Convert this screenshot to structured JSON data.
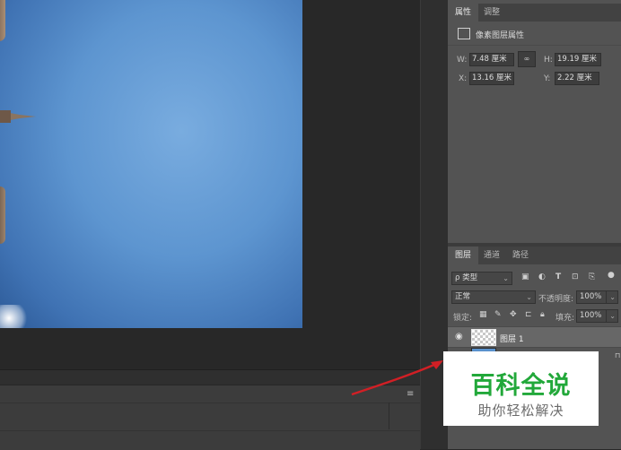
{
  "properties_panel": {
    "tabs": [
      {
        "label": "属性",
        "active": true
      },
      {
        "label": "调整",
        "active": false
      }
    ],
    "title": "像素图层属性",
    "w_label": "W:",
    "w_value": "7.48 厘米",
    "h_label": "H:",
    "h_value": "19.19 厘米",
    "x_label": "X:",
    "x_value": "13.16 厘米",
    "y_label": "Y:",
    "y_value": "2.22 厘米",
    "link_icon": "link-icon"
  },
  "layers_panel": {
    "tabs": [
      {
        "label": "图层",
        "active": true
      },
      {
        "label": "通道",
        "active": false
      },
      {
        "label": "路径",
        "active": false
      }
    ],
    "filter_label": "ρ 类型",
    "blend_mode": "正常",
    "opacity_label": "不透明度:",
    "opacity_value": "100%",
    "lock_label": "锁定:",
    "fill_label": "填充:",
    "fill_value": "100%",
    "layers": [
      {
        "name": "图层 1",
        "visible": true,
        "selected": true
      },
      {
        "name": "",
        "visible": false,
        "selected": false,
        "locked": true
      }
    ]
  },
  "watermark": {
    "title": "百科全说",
    "subtitle": "助你轻松解决"
  },
  "colors": {
    "accent_green": "#22a83a",
    "arrow_red": "#d21f25",
    "panel_bg": "#535353",
    "canvas_bg": "#282828"
  }
}
